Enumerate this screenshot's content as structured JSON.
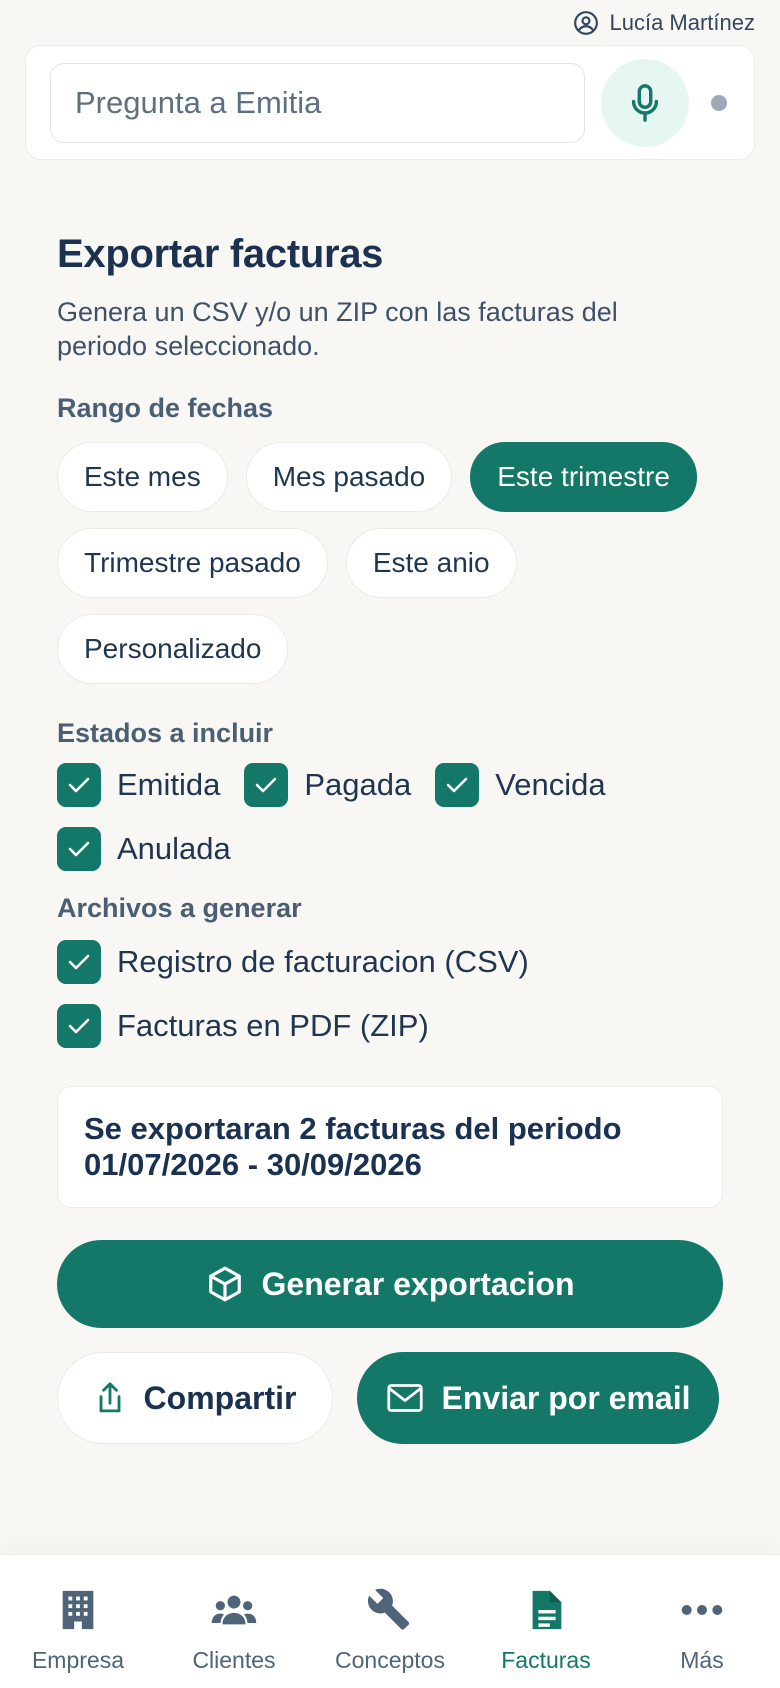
{
  "user": {
    "name": "Lucía Martínez",
    "icon": "user-circle-icon"
  },
  "ask": {
    "placeholder": "Pregunta a Emitia",
    "mic_icon": "microphone-icon"
  },
  "export": {
    "title": "Exportar facturas",
    "subtitle": "Genera un CSV y/o un ZIP con las facturas del periodo seleccionado.",
    "range_label": "Rango de fechas",
    "range_options": [
      {
        "label": "Este mes",
        "selected": false
      },
      {
        "label": "Mes pasado",
        "selected": false
      },
      {
        "label": "Este trimestre",
        "selected": true
      },
      {
        "label": "Trimestre pasado",
        "selected": false
      },
      {
        "label": "Este anio",
        "selected": false
      },
      {
        "label": "Personalizado",
        "selected": false
      }
    ],
    "states_label": "Estados a incluir",
    "states": [
      {
        "label": "Emitida",
        "checked": true
      },
      {
        "label": "Pagada",
        "checked": true
      },
      {
        "label": "Vencida",
        "checked": true
      },
      {
        "label": "Anulada",
        "checked": true
      }
    ],
    "files_label": "Archivos a generar",
    "files": [
      {
        "label": "Registro de facturacion (CSV)",
        "checked": true
      },
      {
        "label": "Facturas en PDF (ZIP)",
        "checked": true
      }
    ],
    "summary": "Se exportaran 2 facturas del periodo 01/07/2026 - 30/09/2026",
    "generate_label": "Generar exportacion",
    "share_label": "Compartir",
    "email_label": "Enviar por email"
  },
  "nav": [
    {
      "label": "Empresa",
      "icon": "building-icon",
      "active": false
    },
    {
      "label": "Clientes",
      "icon": "users-icon",
      "active": false
    },
    {
      "label": "Conceptos",
      "icon": "wrench-icon",
      "active": false
    },
    {
      "label": "Facturas",
      "icon": "document-icon",
      "active": true
    },
    {
      "label": "Más",
      "icon": "more-dots-icon",
      "active": false
    }
  ],
  "colors": {
    "accent": "#137868",
    "text": "#1f3550",
    "background": "#f8f7f4"
  }
}
